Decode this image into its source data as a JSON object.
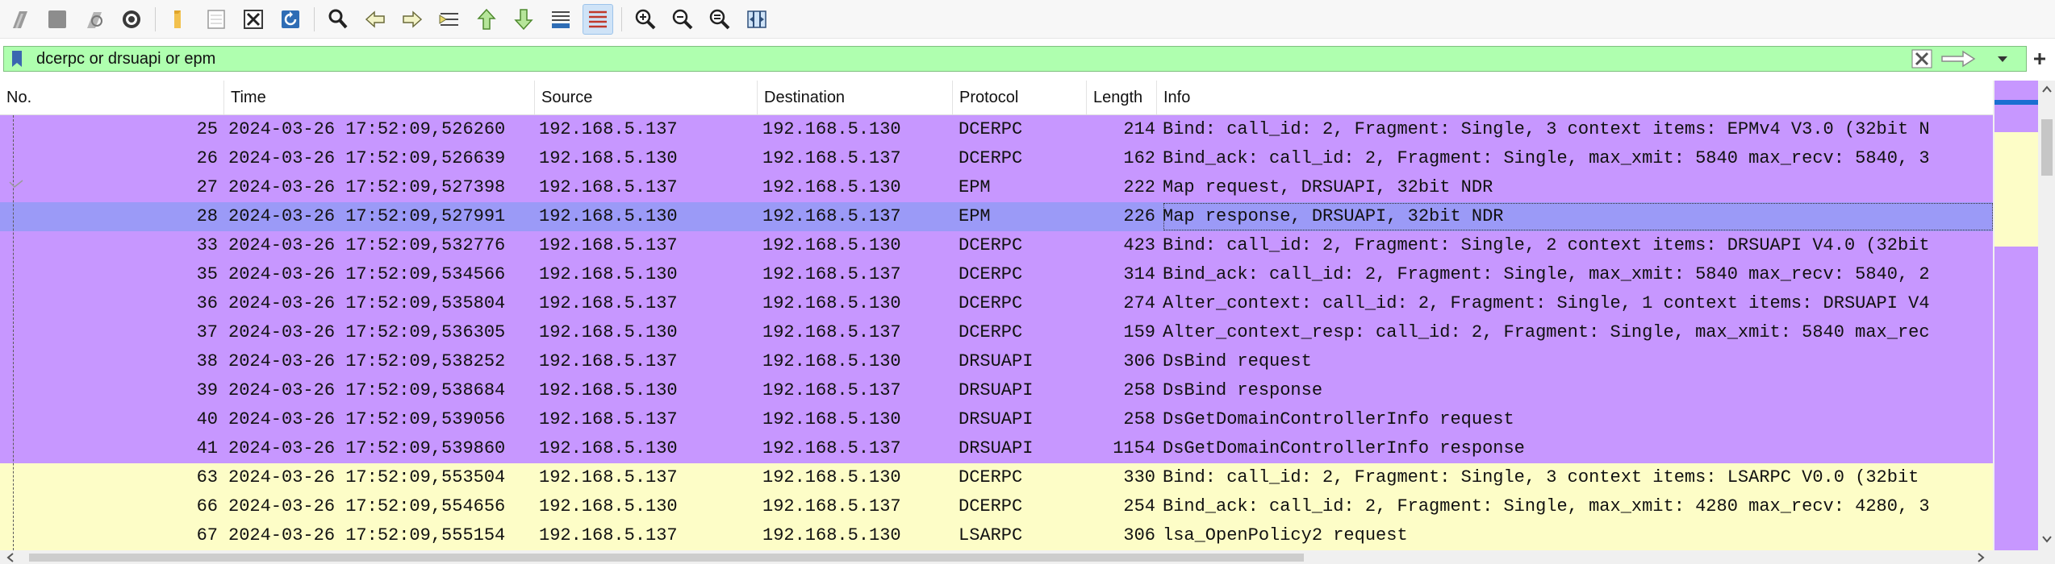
{
  "toolbar": {
    "buttons": [
      {
        "name": "start-capture-icon"
      },
      {
        "name": "stop-capture-icon"
      },
      {
        "name": "restart-capture-icon"
      },
      {
        "name": "capture-options-icon"
      },
      {
        "name": "open-file-icon"
      },
      {
        "name": "save-file-icon"
      },
      {
        "name": "close-file-icon"
      },
      {
        "name": "reload-file-icon"
      },
      {
        "name": "find-packet-icon"
      },
      {
        "name": "go-back-icon"
      },
      {
        "name": "go-forward-icon"
      },
      {
        "name": "go-to-packet-icon"
      },
      {
        "name": "go-to-first-icon"
      },
      {
        "name": "go-to-last-icon"
      },
      {
        "name": "auto-scroll-icon"
      },
      {
        "name": "colorize-icon"
      },
      {
        "name": "zoom-in-icon"
      },
      {
        "name": "zoom-out-icon"
      },
      {
        "name": "normal-size-icon"
      },
      {
        "name": "resize-columns-icon"
      }
    ]
  },
  "filter": {
    "value": "dcerpc or drsuapi or epm",
    "background": "#afffaf"
  },
  "columns": [
    "No.",
    "Time",
    "Source",
    "Destination",
    "Protocol",
    "Length",
    "Info"
  ],
  "colors": {
    "dcerpc_row": "#c797ff",
    "selected_row": "#9b9af7",
    "lsarpc_row": "#fdfdc7",
    "minimap_mark": "#1a6fd1"
  },
  "rows": [
    {
      "no": "25",
      "time": "2024-03-26 17:52:09,526260",
      "src": "192.168.5.137",
      "dst": "192.168.5.130",
      "proto": "DCERPC",
      "len": "214",
      "info": "Bind: call_id: 2, Fragment: Single, 3 context items: EPMv4 V3.0 (32bit N",
      "style": "dcerpc"
    },
    {
      "no": "26",
      "time": "2024-03-26 17:52:09,526639",
      "src": "192.168.5.130",
      "dst": "192.168.5.137",
      "proto": "DCERPC",
      "len": "162",
      "info": "Bind_ack: call_id: 2, Fragment: Single, max_xmit: 5840 max_recv: 5840, 3",
      "style": "dcerpc"
    },
    {
      "no": "27",
      "time": "2024-03-26 17:52:09,527398",
      "src": "192.168.5.137",
      "dst": "192.168.5.130",
      "proto": "EPM",
      "len": "222",
      "info": "Map request, DRSUAPI, 32bit NDR",
      "style": "dcerpc"
    },
    {
      "no": "28",
      "time": "2024-03-26 17:52:09,527991",
      "src": "192.168.5.130",
      "dst": "192.168.5.137",
      "proto": "EPM",
      "len": "226",
      "info": "Map response, DRSUAPI, 32bit NDR",
      "style": "selected"
    },
    {
      "no": "33",
      "time": "2024-03-26 17:52:09,532776",
      "src": "192.168.5.137",
      "dst": "192.168.5.130",
      "proto": "DCERPC",
      "len": "423",
      "info": "Bind: call_id: 2, Fragment: Single, 2 context items: DRSUAPI V4.0 (32bit",
      "style": "dcerpc"
    },
    {
      "no": "35",
      "time": "2024-03-26 17:52:09,534566",
      "src": "192.168.5.130",
      "dst": "192.168.5.137",
      "proto": "DCERPC",
      "len": "314",
      "info": "Bind_ack: call_id: 2, Fragment: Single, max_xmit: 5840 max_recv: 5840, 2",
      "style": "dcerpc"
    },
    {
      "no": "36",
      "time": "2024-03-26 17:52:09,535804",
      "src": "192.168.5.137",
      "dst": "192.168.5.130",
      "proto": "DCERPC",
      "len": "274",
      "info": "Alter_context: call_id: 2, Fragment: Single, 1 context items: DRSUAPI V4",
      "style": "dcerpc"
    },
    {
      "no": "37",
      "time": "2024-03-26 17:52:09,536305",
      "src": "192.168.5.130",
      "dst": "192.168.5.137",
      "proto": "DCERPC",
      "len": "159",
      "info": "Alter_context_resp: call_id: 2, Fragment: Single, max_xmit: 5840 max_rec",
      "style": "dcerpc"
    },
    {
      "no": "38",
      "time": "2024-03-26 17:52:09,538252",
      "src": "192.168.5.137",
      "dst": "192.168.5.130",
      "proto": "DRSUAPI",
      "len": "306",
      "info": "DsBind request",
      "style": "dcerpc"
    },
    {
      "no": "39",
      "time": "2024-03-26 17:52:09,538684",
      "src": "192.168.5.130",
      "dst": "192.168.5.137",
      "proto": "DRSUAPI",
      "len": "258",
      "info": "DsBind response",
      "style": "dcerpc"
    },
    {
      "no": "40",
      "time": "2024-03-26 17:52:09,539056",
      "src": "192.168.5.137",
      "dst": "192.168.5.130",
      "proto": "DRSUAPI",
      "len": "258",
      "info": "DsGetDomainControllerInfo request",
      "style": "dcerpc"
    },
    {
      "no": "41",
      "time": "2024-03-26 17:52:09,539860",
      "src": "192.168.5.130",
      "dst": "192.168.5.137",
      "proto": "DRSUAPI",
      "len": "1154",
      "info": "DsGetDomainControllerInfo response",
      "style": "dcerpc"
    },
    {
      "no": "63",
      "time": "2024-03-26 17:52:09,553504",
      "src": "192.168.5.137",
      "dst": "192.168.5.130",
      "proto": "DCERPC",
      "len": "330",
      "info": "Bind: call_id: 2, Fragment: Single, 3 context items: LSARPC V0.0 (32bit",
      "style": "lsarpc"
    },
    {
      "no": "66",
      "time": "2024-03-26 17:52:09,554656",
      "src": "192.168.5.130",
      "dst": "192.168.5.137",
      "proto": "DCERPC",
      "len": "254",
      "info": "Bind_ack: call_id: 2, Fragment: Single, max_xmit: 4280 max_recv: 4280, 3",
      "style": "lsarpc"
    },
    {
      "no": "67",
      "time": "2024-03-26 17:52:09,555154",
      "src": "192.168.5.137",
      "dst": "192.168.5.130",
      "proto": "LSARPC",
      "len": "306",
      "info": "lsa_OpenPolicy2 request",
      "style": "lsarpc"
    }
  ]
}
